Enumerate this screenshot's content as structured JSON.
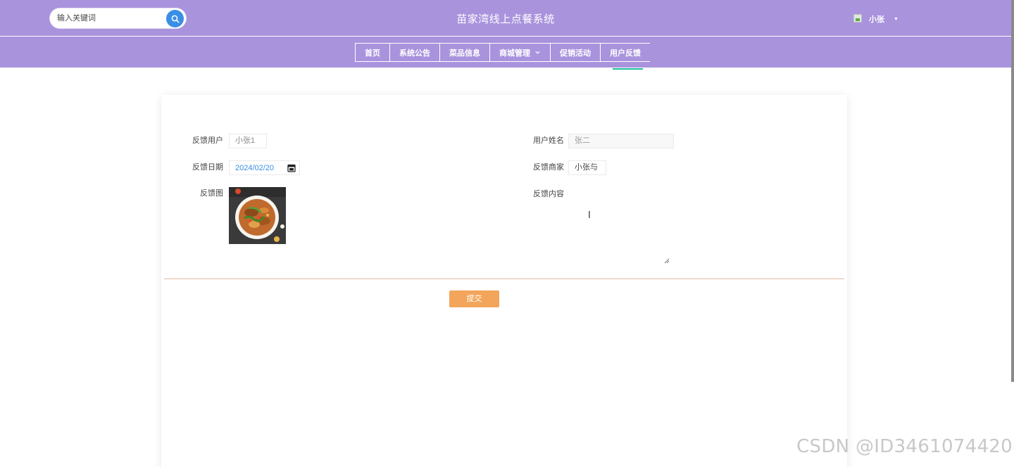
{
  "search": {
    "placeholder": "输入关键词"
  },
  "header": {
    "title": "苗家湾线上点餐系统",
    "username": "小张"
  },
  "nav": {
    "items": [
      {
        "label": "首页"
      },
      {
        "label": "系统公告"
      },
      {
        "label": "菜品信息"
      },
      {
        "label": "商城管理"
      },
      {
        "label": "促销活动"
      },
      {
        "label": "用户反馈"
      }
    ],
    "active": "用户反馈"
  },
  "form": {
    "feedback_user_label": "反馈用户",
    "feedback_user_value": "小张1",
    "user_name_label": "用户姓名",
    "user_name_value": "张二",
    "feedback_date_label": "反馈日期",
    "feedback_date_value": "2024/02/20",
    "merchant_label": "反馈商家",
    "merchant_value": "小张与",
    "image_label": "反馈图",
    "content_label": "反馈内容",
    "content_value": "",
    "submit_label": "提交"
  },
  "watermark": "CSDN @ID3461074420",
  "colors": {
    "header_bg": "#a993dd",
    "accent_blue": "#3a8ee6",
    "submit_bg": "#f2a55b",
    "active_underline": "#1abc9c"
  }
}
